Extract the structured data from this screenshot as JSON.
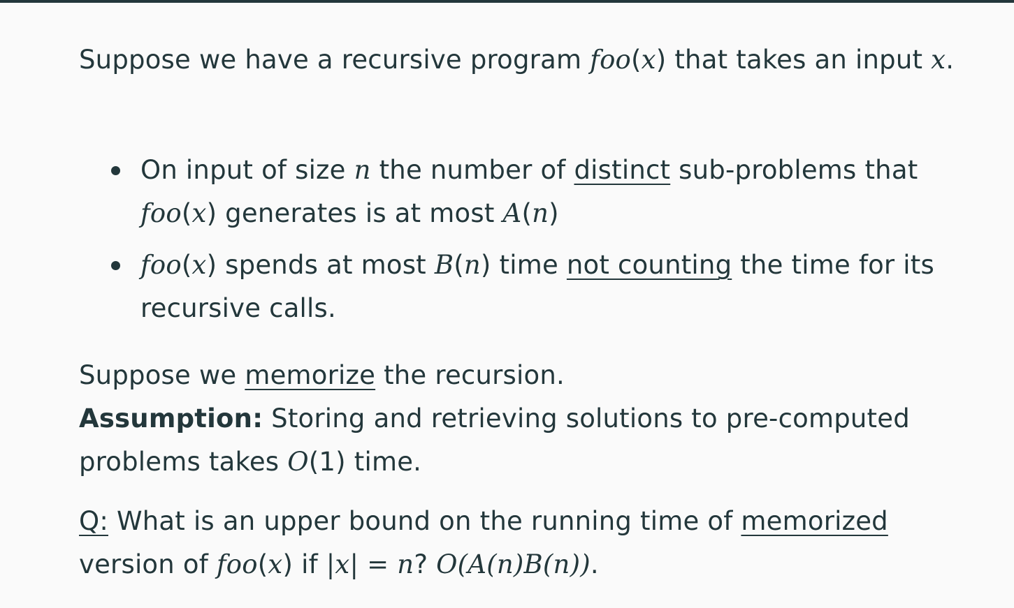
{
  "intro": {
    "t1": "Suppose we have a recursive program ",
    "foo": "foo",
    "lp": "(",
    "x": "x",
    "rp": ")",
    "t2": " that takes an input ",
    "x2": "x",
    "t3": "."
  },
  "bullets": [
    {
      "l1_a": "On input of size ",
      "l1_n": "n",
      "l1_b": " the number of ",
      "l1_u": "distinct",
      "l1_c": " sub-problems that",
      "l2_foo": "foo",
      "l2_lp": "(",
      "l2_x": "x",
      "l2_rp": ")",
      "l2_a": " generates is at most ",
      "l2_A": "A",
      "l2_lp2": "(",
      "l2_n": "n",
      "l2_rp2": ")"
    },
    {
      "l1_foo": "foo",
      "l1_lp": "(",
      "l1_x": "x",
      "l1_rp": ")",
      "l1_a": " spends at most ",
      "l1_B": "B",
      "l1_lp2": "(",
      "l1_n": "n",
      "l1_rp2": ")",
      "l1_b": " time ",
      "l1_u": "not counting",
      "l1_c": " the time for its",
      "l2": "recursive calls."
    }
  ],
  "memo": {
    "a": "Suppose we ",
    "u": "memorize",
    "b": " the recursion."
  },
  "assumption": {
    "label": "Assumption:",
    "l1": " Storing and retrieving solutions to pre-computed",
    "l2_a": "problems takes ",
    "l2_O": "O",
    "l2_arg": "(1)",
    "l2_b": " time."
  },
  "question": {
    "q": "Q:",
    "l1_a": " What is an upper bound on the running time of ",
    "l1_u": "memorized",
    "l2_a": "version of ",
    "l2_foo": "foo",
    "l2_lp": "(",
    "l2_x": "x",
    "l2_rp": ")",
    "l2_b": " if ",
    "l2_abs": "|x| = ",
    "l2_n": "n",
    "l2_q": "?  ",
    "answer": "O(A(n)B(n))",
    "l2_end": "."
  }
}
